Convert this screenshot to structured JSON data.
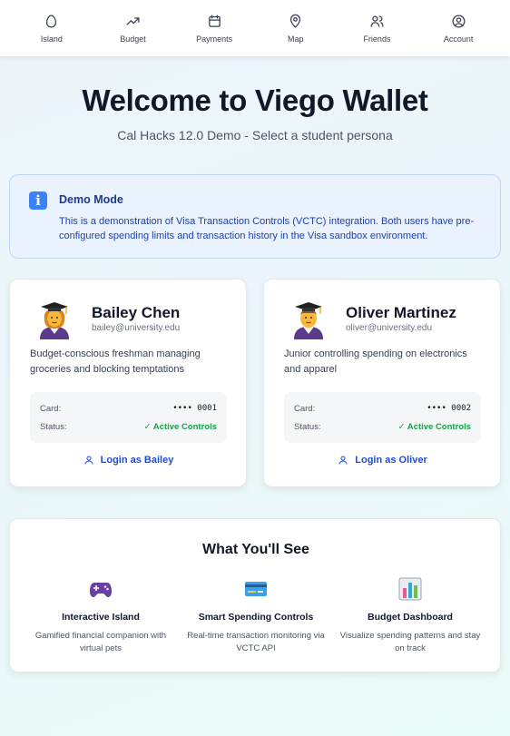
{
  "nav": {
    "items": [
      {
        "label": "Island",
        "icon": "egg-icon"
      },
      {
        "label": "Budget",
        "icon": "trending-up-icon"
      },
      {
        "label": "Payments",
        "icon": "calendar-icon"
      },
      {
        "label": "Map",
        "icon": "map-pin-icon"
      },
      {
        "label": "Friends",
        "icon": "users-icon"
      },
      {
        "label": "Account",
        "icon": "user-circle-icon"
      }
    ]
  },
  "header": {
    "title": "Welcome to Viego Wallet",
    "subtitle": "Cal Hacks 12.0 Demo - Select a student persona"
  },
  "demo": {
    "icon": "info-icon",
    "title": "Demo Mode",
    "text": "This is a demonstration of Visa Transaction Controls (VCTC) integration. Both users have pre-configured spending limits and transaction history in the Visa sandbox environment."
  },
  "personas": [
    {
      "name": "Bailey Chen",
      "email": "bailey@university.edu",
      "description": "Budget-conscious freshman managing groceries and blocking temptations",
      "card_label": "Card:",
      "card_value": "•••• 0001",
      "status_label": "Status:",
      "status_value": "✓ Active Controls",
      "login_label": "Login as Bailey"
    },
    {
      "name": "Oliver Martinez",
      "email": "oliver@university.edu",
      "description": "Junior controlling spending on electronics and apparel",
      "card_label": "Card:",
      "card_value": "•••• 0002",
      "status_label": "Status:",
      "status_value": "✓ Active Controls",
      "login_label": "Login as Oliver"
    }
  ],
  "features": {
    "title": "What You'll See",
    "items": [
      {
        "icon": "game-controller-icon",
        "title": "Interactive Island",
        "description": "Gamified financial companion with virtual pets"
      },
      {
        "icon": "credit-card-icon",
        "title": "Smart Spending Controls",
        "description": "Real-time transaction monitoring via VCTC API"
      },
      {
        "icon": "bar-chart-icon",
        "title": "Budget Dashboard",
        "description": "Visualize spending patterns and stay on track"
      }
    ]
  },
  "colors": {
    "accent": "#1d4ed8",
    "status_green": "#16a34a",
    "info_blue": "#3b82f6"
  }
}
